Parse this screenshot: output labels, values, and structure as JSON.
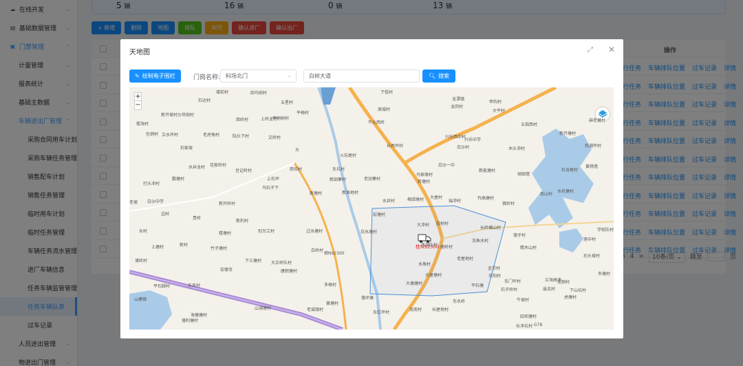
{
  "sidebar": {
    "items": [
      {
        "label": "在线开发",
        "level": 0,
        "icon": "cloud-icon",
        "arrow": "⌄"
      },
      {
        "label": "基础数据管理",
        "level": 0,
        "icon": "database-icon",
        "arrow": "⌄"
      },
      {
        "label": "门禁管理",
        "level": 0,
        "icon": "gate-icon",
        "arrow": "⌃",
        "active": true
      },
      {
        "label": "计量管理",
        "level": 1,
        "arrow": "⌄"
      },
      {
        "label": "报表统计",
        "level": 1,
        "arrow": "⌄"
      },
      {
        "label": "基础主数据",
        "level": 1,
        "arrow": "⌄"
      },
      {
        "label": "车辆进出厂管理",
        "level": 1,
        "arrow": "⌃",
        "active": true
      },
      {
        "label": "采购合同用车计划",
        "level": 2
      },
      {
        "label": "采购车辆任务管理",
        "level": 2
      },
      {
        "label": "销售配车计划",
        "level": 2
      },
      {
        "label": "销售任务管理",
        "level": 2
      },
      {
        "label": "临时用车计划",
        "level": 2
      },
      {
        "label": "临时任务管理",
        "level": 2
      },
      {
        "label": "车辆任务流水管理",
        "level": 2
      },
      {
        "label": "进厂车辆信息",
        "level": 2
      },
      {
        "label": "任务车辆监管管理",
        "level": 2
      },
      {
        "label": "任务车辆队表",
        "level": 2,
        "selected": true
      },
      {
        "label": "过车记录",
        "level": 2
      },
      {
        "label": "人员进出管理",
        "level": 1,
        "arrow": "⌄"
      },
      {
        "label": "物进出门管理",
        "level": 1,
        "arrow": "⌄"
      }
    ]
  },
  "stats": [
    {
      "value": "5",
      "unit": "辆"
    },
    {
      "value": "16",
      "unit": "辆"
    },
    {
      "value": "0",
      "unit": "辆"
    },
    {
      "value": "13",
      "unit": "辆"
    }
  ],
  "toolbar": {
    "add": "+ 新增",
    "delete": "删除",
    "map": "地图",
    "queue": "排队",
    "call": "叫号",
    "confirm_in": "确认进厂",
    "confirm_out": "确认出厂"
  },
  "table": {
    "op_header": "操作",
    "row_links": [
      "行任务",
      "车辆排队位置",
      "过车记录",
      "详情"
    ],
    "row_count": 11
  },
  "pagination": {
    "pages": [
      "3",
      "4"
    ],
    "next": ">",
    "page_size": "10条/页",
    "jump_label": "跳至",
    "page_unit": "页"
  },
  "modal": {
    "title": "天地图",
    "fence_button": "绘制电子围栏",
    "gate_label": "门岗名称:",
    "gate_value": "料场北门",
    "address_value": "白树大道",
    "search_button": "搜索",
    "zoom_in": "+",
    "zoom_out": "−",
    "vehicle_plate": "桂N92300",
    "colors": {
      "fence": "#4a90d9",
      "road_major": "#f6b14e",
      "road_highway": "#a98ad6",
      "water": "#a9cbe8",
      "primary": "#1890ff"
    },
    "places": [
      "增前村",
      "四马田村",
      "五星村",
      "平梅村",
      "石达村",
      "新开坡村沙世田村",
      "西岭村",
      "上岭龙村",
      "平桐树村",
      "下低村",
      "周城村",
      "龙岗村",
      "龙潭镇",
      "大平村",
      "甲的村",
      "楼海村",
      "包销村",
      "立水坪村",
      "老虎角村",
      "陆头下村",
      "文岭村",
      "牛头西岭",
      "长西坪村",
      "兴乐西中村",
      "兴乐中学",
      "五指西村",
      "新开塘村",
      "麻老塘村",
      "热潮坪村",
      "石家坡",
      "大",
      "火坑尾村",
      "白沙村",
      "木头冲村",
      "黄桃墙",
      "水井龙村",
      "花家岭村",
      "豆记岭村",
      "西坎村",
      "东坑村",
      "白沙一中",
      "新能塘村",
      "坳田墙",
      "石龙尾村",
      "打头冲村",
      "鹏塘村",
      "上石坪",
      "新田寨村",
      "老旧寨村",
      "马家墩村",
      "新塘村",
      "乌石子下",
      "新塘村",
      "新埠地村",
      "老坡",
      "白沙中学",
      "新开岭村",
      "水井村",
      "梅绿墩村",
      "大屋村",
      "瑞冲村",
      "竹高塘村",
      "佛岭村",
      "南山村",
      "水托塘村",
      "边村",
      "贵岭",
      "新利村",
      "宏塘村",
      "大冲村",
      "胶树村",
      "长岭横山村",
      "长村",
      "镇子村",
      "学校队村",
      "楼塘村",
      "别万江村",
      "过水塘村",
      "白水塘村",
      "精木山村",
      "上塘村",
      "新村",
      "多湖队村",
      "鹿岭村",
      "洗鱼水村",
      "莲中村",
      "竹子塘村",
      "柳N92300",
      "白岭村",
      "石头坡村",
      "诸岭村",
      "下三塘村",
      "大正岭队村",
      "水角村",
      "老屋地村",
      "宏德寺",
      "唐职塘村",
      "金甘村",
      "东风村",
      "多格村",
      "大屋塘村",
      "大塘塘村",
      "东阳村",
      "石子岭村",
      "平石塘",
      "平石脚村",
      "北侧村",
      "兰海高速",
      "牛坡村",
      "虎塘村",
      "黄塘村",
      "落环塘",
      "东水岭",
      "东门坪村",
      "下山坑村",
      "冬塘村",
      "庙北村",
      "山塘镇",
      "海塘塘村",
      "山湖塘村",
      "落利塘村",
      "老城镇村",
      "四坝塘村",
      "东红坪村",
      "长冲坑村",
      "泥南村",
      "长屋地村",
      "G78"
    ]
  }
}
